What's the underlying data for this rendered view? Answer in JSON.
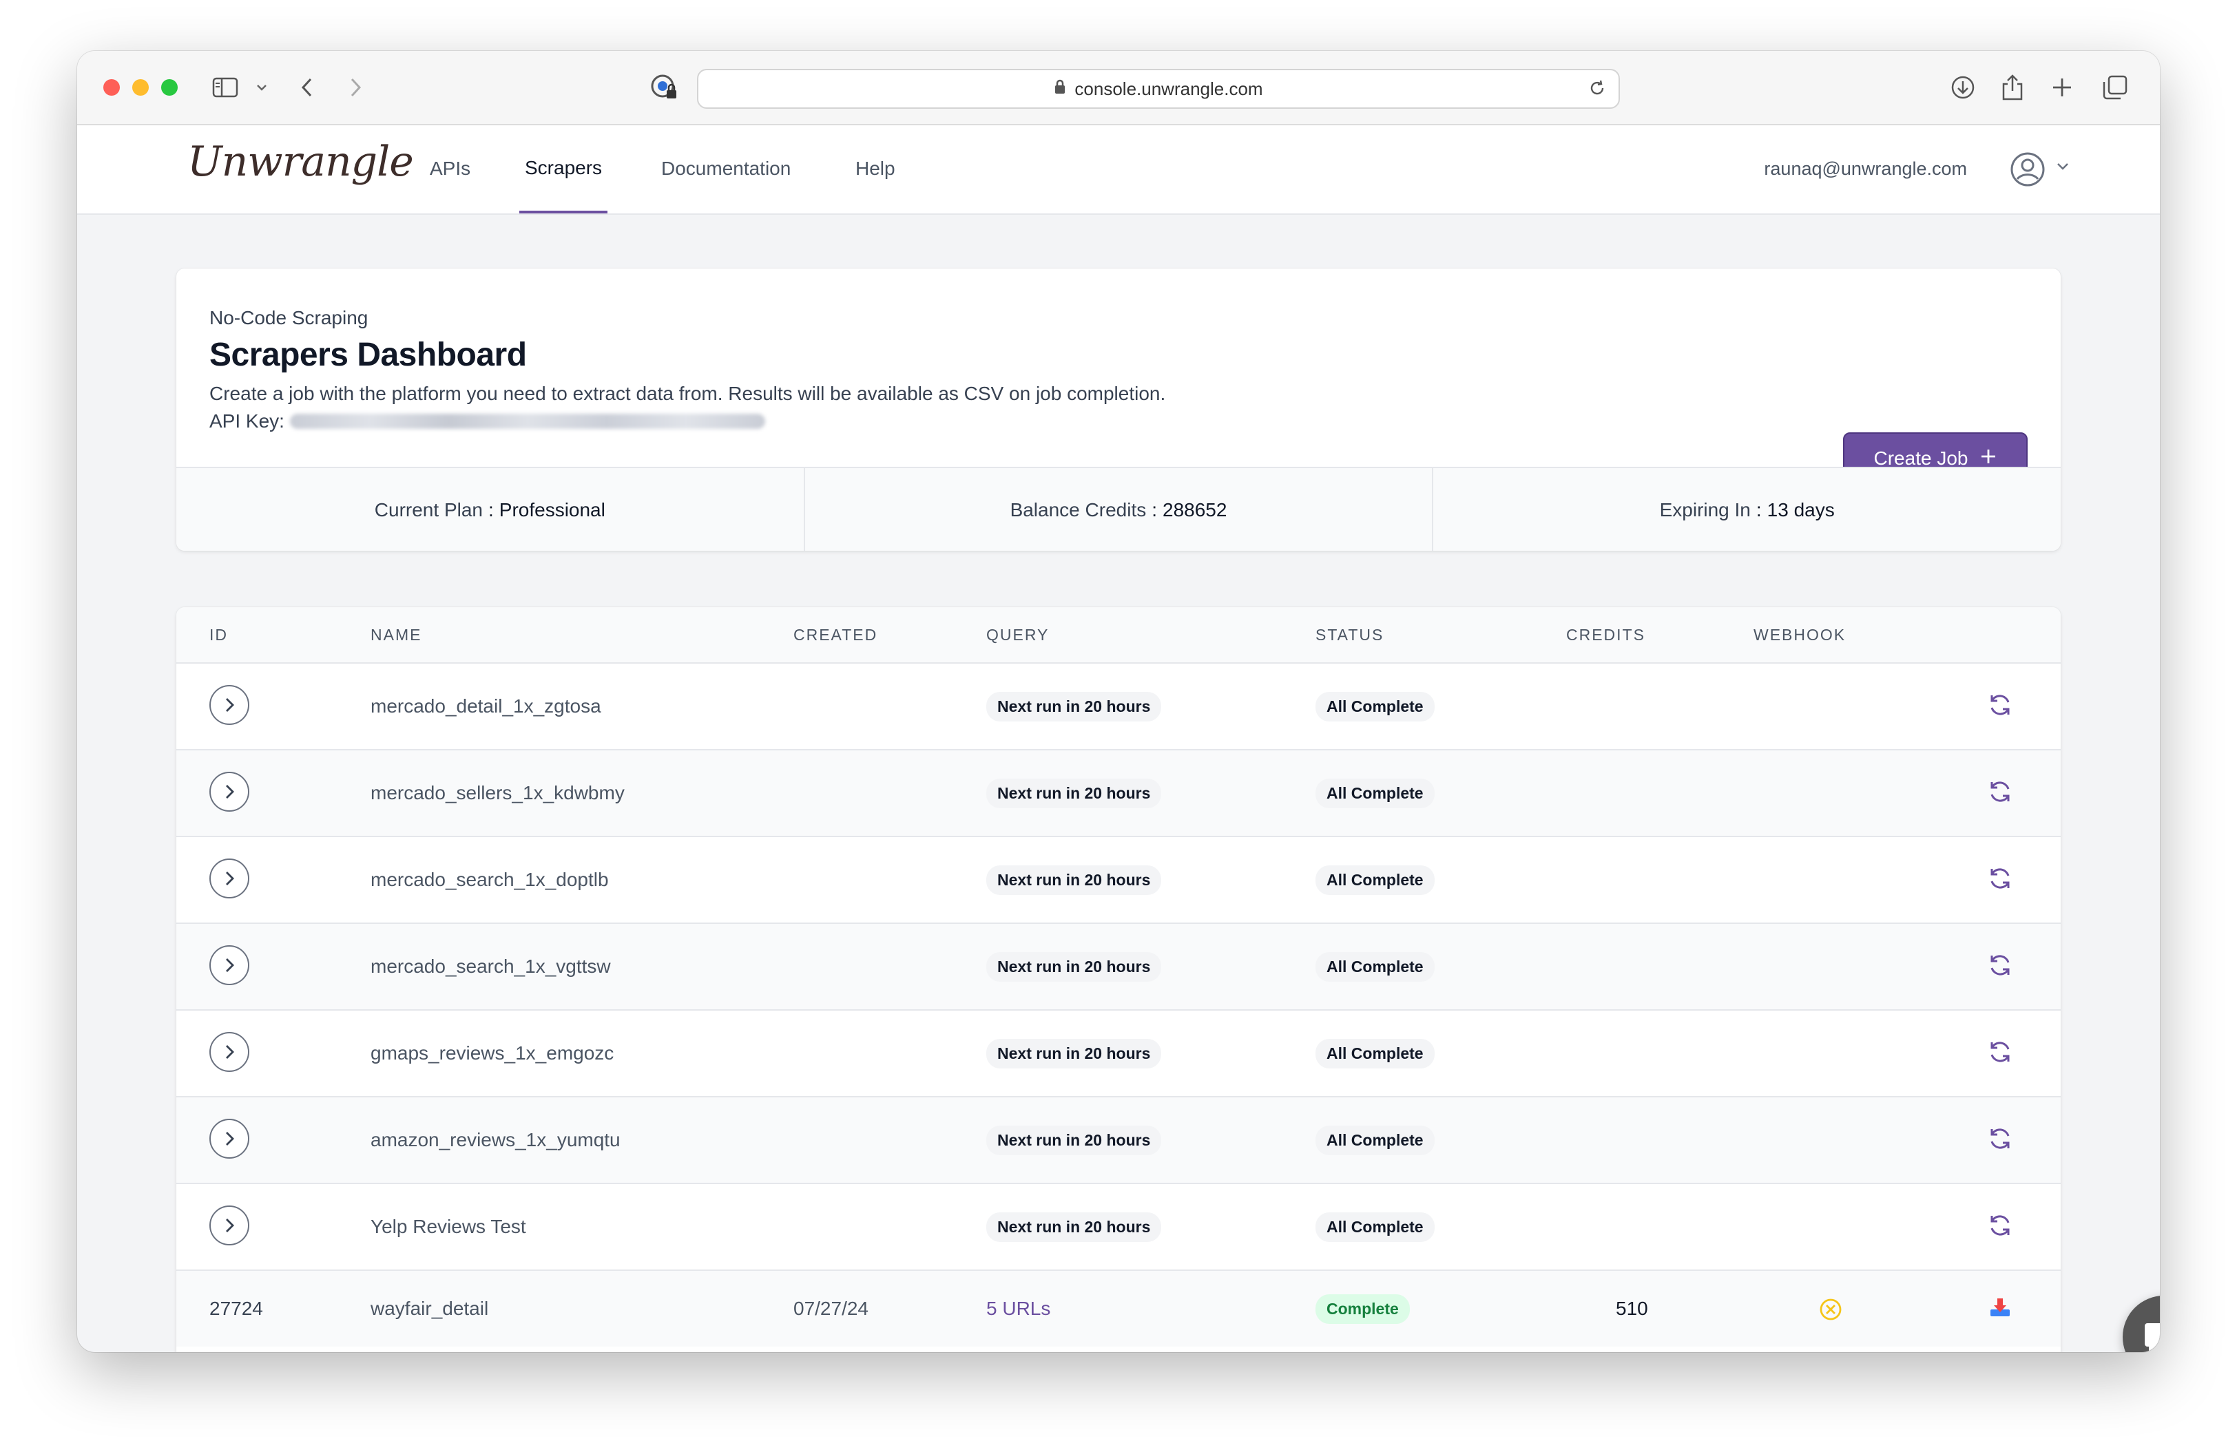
{
  "browser": {
    "url": "console.unwrangle.com"
  },
  "nav": {
    "logo": "Unwrangle",
    "links": [
      "APIs",
      "Scrapers",
      "Documentation",
      "Help"
    ],
    "active": "Scrapers",
    "user_email": "raunaq@unwrangle.com"
  },
  "header": {
    "eyebrow": "No-Code Scraping",
    "title": "Scrapers Dashboard",
    "description": "Create a job with the platform you need to extract data from. Results will be available as CSV on job completion.",
    "api_key_label": "API Key:",
    "create_button": "Create Job"
  },
  "stats": {
    "plan_label": "Current Plan",
    "plan_value": "Professional",
    "credits_label": "Balance Credits",
    "credits_value": "288652",
    "expiry_label": "Expiring In",
    "expiry_value": "13 days"
  },
  "table": {
    "columns": [
      "ID",
      "NAME",
      "CREATED",
      "QUERY",
      "STATUS",
      "CREDITS",
      "WEBHOOK"
    ],
    "rows": [
      {
        "id": "",
        "name": "mercado_detail_1x_zgtosa",
        "created": "",
        "query": "Next run in 20 hours",
        "status": "All Complete",
        "credits": "",
        "webhook": ""
      },
      {
        "id": "",
        "name": "mercado_sellers_1x_kdwbmy",
        "created": "",
        "query": "Next run in 20 hours",
        "status": "All Complete",
        "credits": "",
        "webhook": ""
      },
      {
        "id": "",
        "name": "mercado_search_1x_doptlb",
        "created": "",
        "query": "Next run in 20 hours",
        "status": "All Complete",
        "credits": "",
        "webhook": ""
      },
      {
        "id": "",
        "name": "mercado_search_1x_vgttsw",
        "created": "",
        "query": "Next run in 20 hours",
        "status": "All Complete",
        "credits": "",
        "webhook": ""
      },
      {
        "id": "",
        "name": "gmaps_reviews_1x_emgozc",
        "created": "",
        "query": "Next run in 20 hours",
        "status": "All Complete",
        "credits": "",
        "webhook": ""
      },
      {
        "id": "",
        "name": "amazon_reviews_1x_yumqtu",
        "created": "",
        "query": "Next run in 20 hours",
        "status": "All Complete",
        "credits": "",
        "webhook": ""
      },
      {
        "id": "",
        "name": "Yelp Reviews Test",
        "created": "",
        "query": "Next run in 20 hours",
        "status": "All Complete",
        "credits": "",
        "webhook": ""
      },
      {
        "id": "27724",
        "name": "wayfair_detail",
        "created": "07/27/24",
        "query": "5 URLs",
        "status": "Complete",
        "credits": "510",
        "webhook": ""
      }
    ]
  },
  "icons": {
    "refresh": "refresh-icon",
    "expand": "chevron-right-icon",
    "webhook": "x-circle-icon",
    "download": "download-icon",
    "chat": "chat-icon"
  },
  "colors": {
    "accent": "#6b4fa0",
    "complete_bg": "#dcfce7",
    "complete_text": "#15803d",
    "webhook_warning": "#f5c518"
  }
}
